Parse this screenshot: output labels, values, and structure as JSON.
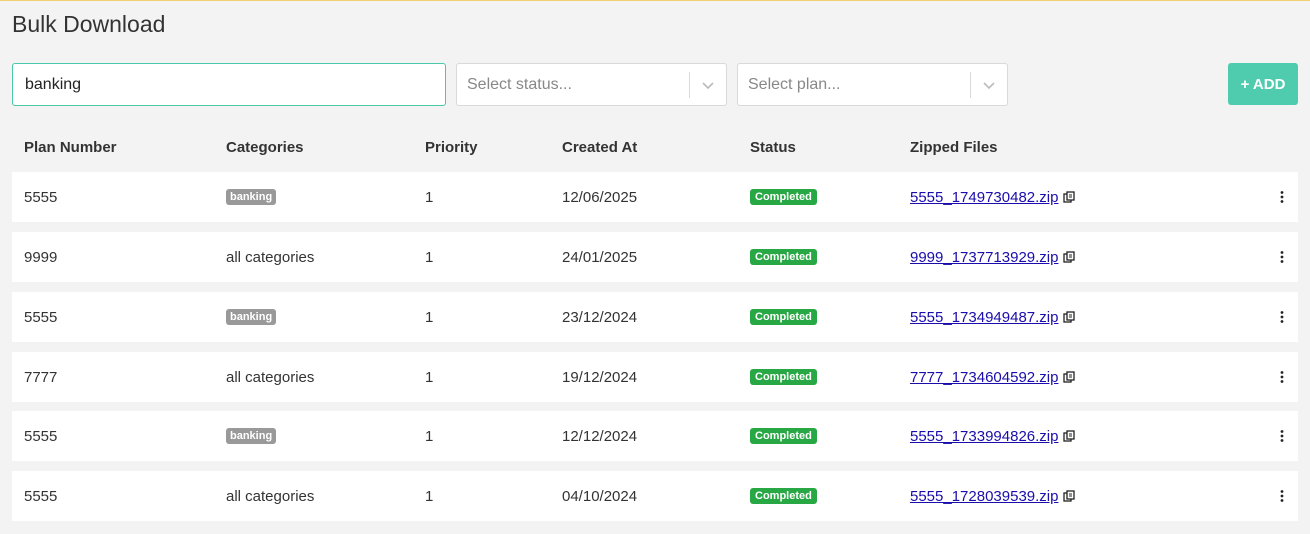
{
  "page": {
    "title": "Bulk Download"
  },
  "filters": {
    "search_value": "banking",
    "status_placeholder": "Select status...",
    "plan_placeholder": "Select plan...",
    "add_label": "+ ADD"
  },
  "table": {
    "columns": {
      "plan_number": "Plan Number",
      "categories": "Categories",
      "priority": "Priority",
      "created_at": "Created At",
      "status": "Status",
      "zipped_files": "Zipped Files"
    },
    "rows": [
      {
        "plan": "5555",
        "category": "banking",
        "category_is_tag": true,
        "priority": "1",
        "created": "12/06/2025",
        "status": "Completed",
        "file": "5555_1749730482.zip"
      },
      {
        "plan": "9999",
        "category": "all categories",
        "category_is_tag": false,
        "priority": "1",
        "created": "24/01/2025",
        "status": "Completed",
        "file": "9999_1737713929.zip"
      },
      {
        "plan": "5555",
        "category": "banking",
        "category_is_tag": true,
        "priority": "1",
        "created": "23/12/2024",
        "status": "Completed",
        "file": "5555_1734949487.zip"
      },
      {
        "plan": "7777",
        "category": "all categories",
        "category_is_tag": false,
        "priority": "1",
        "created": "19/12/2024",
        "status": "Completed",
        "file": "7777_1734604592.zip"
      },
      {
        "plan": "5555",
        "category": "banking",
        "category_is_tag": true,
        "priority": "1",
        "created": "12/12/2024",
        "status": "Completed",
        "file": "5555_1733994826.zip"
      },
      {
        "plan": "5555",
        "category": "all categories",
        "category_is_tag": false,
        "priority": "1",
        "created": "04/10/2024",
        "status": "Completed",
        "file": "5555_1728039539.zip"
      }
    ]
  },
  "colors": {
    "accent": "#4fcbae",
    "status_completed": "#28a745",
    "tag": "#999999",
    "link": "#1a0dab"
  },
  "icons": {
    "select_chevron": "chevron-down-icon",
    "copy": "copy-icon",
    "row_menu": "kebab-menu-icon"
  }
}
